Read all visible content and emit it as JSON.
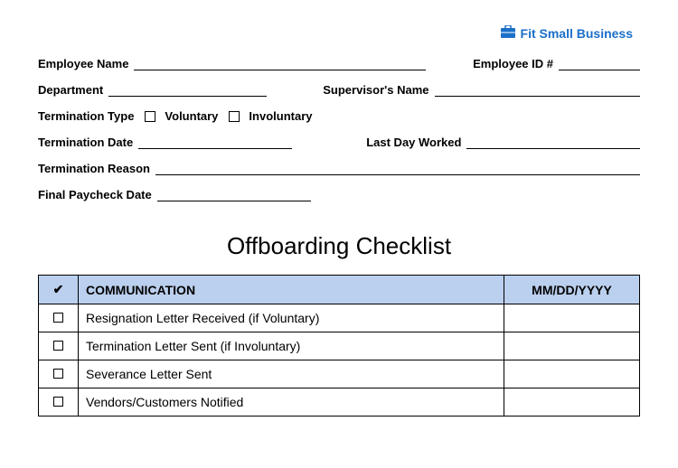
{
  "brand": {
    "name": "Fit Small Business"
  },
  "form": {
    "employee_name": "Employee Name",
    "employee_id": "Employee ID #",
    "department": "Department",
    "supervisor": "Supervisor's Name",
    "termination_type_label": "Termination Type",
    "voluntary": "Voluntary",
    "involuntary": "Involuntary",
    "termination_date": "Termination Date",
    "last_day_worked": "Last Day Worked",
    "termination_reason": "Termination Reason",
    "final_paycheck_date": "Final Paycheck Date"
  },
  "checklist": {
    "title": "Offboarding Checklist",
    "headers": {
      "check": "✔",
      "section": "COMMUNICATION",
      "date": "MM/DD/YYYY"
    },
    "rows": [
      {
        "label": "Resignation Letter Received (if Voluntary)"
      },
      {
        "label": "Termination Letter Sent (if Involuntary)"
      },
      {
        "label": "Severance Letter Sent"
      },
      {
        "label": "Vendors/Customers Notified"
      }
    ]
  }
}
